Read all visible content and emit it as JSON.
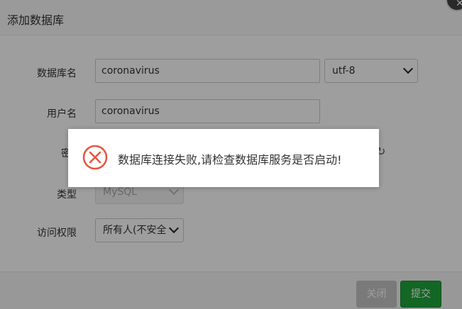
{
  "dialog": {
    "title": "添加数据库"
  },
  "form": {
    "db_name_label": "数据库名",
    "db_name_value": "coronavirus",
    "charset_value": "utf-8",
    "username_label": "用户名",
    "username_value": "coronavirus",
    "password_label_partial": "密",
    "type_label": "类型",
    "type_value": "MySQL",
    "access_label": "访问权限",
    "access_value": "所有人(不安全"
  },
  "footer": {
    "close_label": "关闭",
    "submit_label": "提交"
  },
  "toast": {
    "message": "数据库连接失败,请检查数据库服务是否启动!",
    "icon": "error-x-circle-icon"
  },
  "colors": {
    "accent_green": "#20a53a",
    "error_red": "#e8543f"
  }
}
